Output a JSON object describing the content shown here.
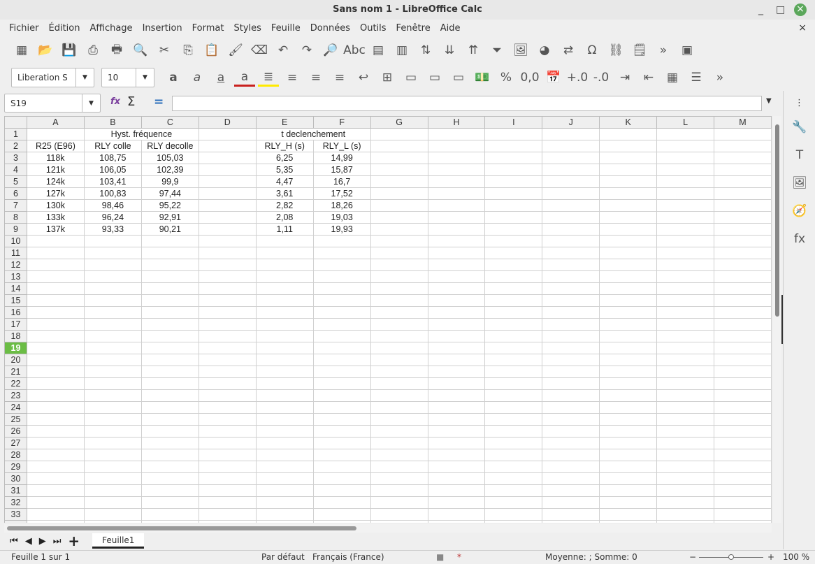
{
  "window": {
    "title": "Sans nom 1 - LibreOffice Calc",
    "minimize": "_",
    "maximize": "□",
    "close": "×"
  },
  "menu": [
    "Fichier",
    "Édition",
    "Affichage",
    "Insertion",
    "Format",
    "Styles",
    "Feuille",
    "Données",
    "Outils",
    "Fenêtre",
    "Aide"
  ],
  "menu_close": "×",
  "toolbar1": [
    {
      "name": "new",
      "g": "▦"
    },
    {
      "name": "open",
      "g": "📂"
    },
    {
      "name": "save",
      "g": "💾"
    },
    {
      "name": "export-pdf",
      "g": "⎙"
    },
    {
      "name": "print",
      "g": "🖶"
    },
    {
      "name": "print-preview",
      "g": "🔍"
    },
    {
      "name": "cut",
      "g": "✂"
    },
    {
      "name": "copy",
      "g": "⎘"
    },
    {
      "name": "paste",
      "g": "📋"
    },
    {
      "name": "clone-formatting",
      "g": "🖌"
    },
    {
      "name": "clear-formatting",
      "g": "⌫"
    },
    {
      "name": "undo",
      "g": "↶"
    },
    {
      "name": "redo",
      "g": "↷"
    },
    {
      "name": "find-replace",
      "g": "🔎"
    },
    {
      "name": "spelling",
      "g": "Abc"
    },
    {
      "name": "row",
      "g": "▤"
    },
    {
      "name": "column",
      "g": "▥"
    },
    {
      "name": "sort",
      "g": "⇅"
    },
    {
      "name": "sort-descending",
      "g": "⇊"
    },
    {
      "name": "sort-ascending",
      "g": "⇈"
    },
    {
      "name": "autofilter",
      "g": "⏷"
    },
    {
      "name": "image",
      "g": "🖼"
    },
    {
      "name": "chart",
      "g": "◕"
    },
    {
      "name": "pivot-table",
      "g": "⇄"
    },
    {
      "name": "special-character",
      "g": "Ω"
    },
    {
      "name": "hyperlink",
      "g": "⛓"
    },
    {
      "name": "comment",
      "g": "🗒"
    },
    {
      "name": "more",
      "g": "»"
    },
    {
      "name": "sidebar-toggle",
      "g": "▣"
    }
  ],
  "toolbar2": {
    "font_name": "Liberation S",
    "font_size": "10",
    "buttons": [
      {
        "name": "bold",
        "g": "a"
      },
      {
        "name": "italic",
        "g": "a"
      },
      {
        "name": "underline",
        "g": "a"
      },
      {
        "name": "font-color",
        "g": "a"
      },
      {
        "name": "highlight",
        "g": "≣"
      },
      {
        "name": "align-left",
        "g": "≡"
      },
      {
        "name": "align-center",
        "g": "≡"
      },
      {
        "name": "align-right",
        "g": "≡"
      },
      {
        "name": "wrap-text",
        "g": "↩"
      },
      {
        "name": "merge-cells",
        "g": "⊞"
      },
      {
        "name": "align-top",
        "g": "▭"
      },
      {
        "name": "align-middle",
        "g": "▭"
      },
      {
        "name": "align-bottom",
        "g": "▭"
      },
      {
        "name": "currency",
        "g": "💵"
      },
      {
        "name": "percent",
        "g": "%"
      },
      {
        "name": "number",
        "g": "0,0"
      },
      {
        "name": "date",
        "g": "📅"
      },
      {
        "name": "add-decimal",
        "g": "+.0"
      },
      {
        "name": "delete-decimal",
        "g": "-.0"
      },
      {
        "name": "increase-indent",
        "g": "⇥"
      },
      {
        "name": "decrease-indent",
        "g": "⇤"
      },
      {
        "name": "borders",
        "g": "▦"
      },
      {
        "name": "border-style",
        "g": "☰"
      },
      {
        "name": "more",
        "g": "»"
      }
    ]
  },
  "formula_bar": {
    "name_box": "S19",
    "formula": "",
    "sum": "Σ",
    "equals": "=",
    "fx": "fx"
  },
  "sheet": {
    "columns": [
      "A",
      "B",
      "C",
      "D",
      "E",
      "F",
      "G",
      "H",
      "I",
      "J",
      "K",
      "L",
      "M"
    ],
    "row_count": 34,
    "selected_row": 19,
    "cells": [
      [
        "",
        "Hyst. fréquence",
        "",
        "",
        "t declenchement",
        ""
      ],
      [
        "R25 (E96)",
        "RLY colle",
        "RLY decolle",
        "",
        "RLY_H (s)",
        "RLY_L (s)"
      ],
      [
        "118k",
        "108,75",
        "105,03",
        "",
        "6,25",
        "14,99"
      ],
      [
        "121k",
        "106,05",
        "102,39",
        "",
        "5,35",
        "15,87"
      ],
      [
        "124k",
        "103,41",
        "99,9",
        "",
        "4,47",
        "16,7"
      ],
      [
        "127k",
        "100,83",
        "97,44",
        "",
        "3,61",
        "17,52"
      ],
      [
        "130k",
        "98,46",
        "95,22",
        "",
        "2,82",
        "18,26"
      ],
      [
        "133k",
        "96,24",
        "92,91",
        "",
        "2,08",
        "19,03"
      ],
      [
        "137k",
        "93,33",
        "90,21",
        "",
        "1,11",
        "19,93"
      ]
    ]
  },
  "sidebar": [
    {
      "name": "properties",
      "g": "🔧"
    },
    {
      "name": "styles",
      "g": "T"
    },
    {
      "name": "gallery",
      "g": "🖼"
    },
    {
      "name": "navigator",
      "g": "🧭"
    },
    {
      "name": "functions",
      "g": "fx"
    }
  ],
  "sidebar_menu": "⋮",
  "tabs": {
    "nav": [
      "⏮",
      "◀",
      "▶",
      "⏭"
    ],
    "add": "+",
    "sheets": [
      "Feuille1"
    ]
  },
  "status": {
    "sheet": "Feuille 1 sur 1",
    "style": "Par défaut",
    "language": "Français (France)",
    "summary": "Moyenne: ; Somme: 0",
    "zoom": "100 %",
    "zoom_level": 100
  }
}
